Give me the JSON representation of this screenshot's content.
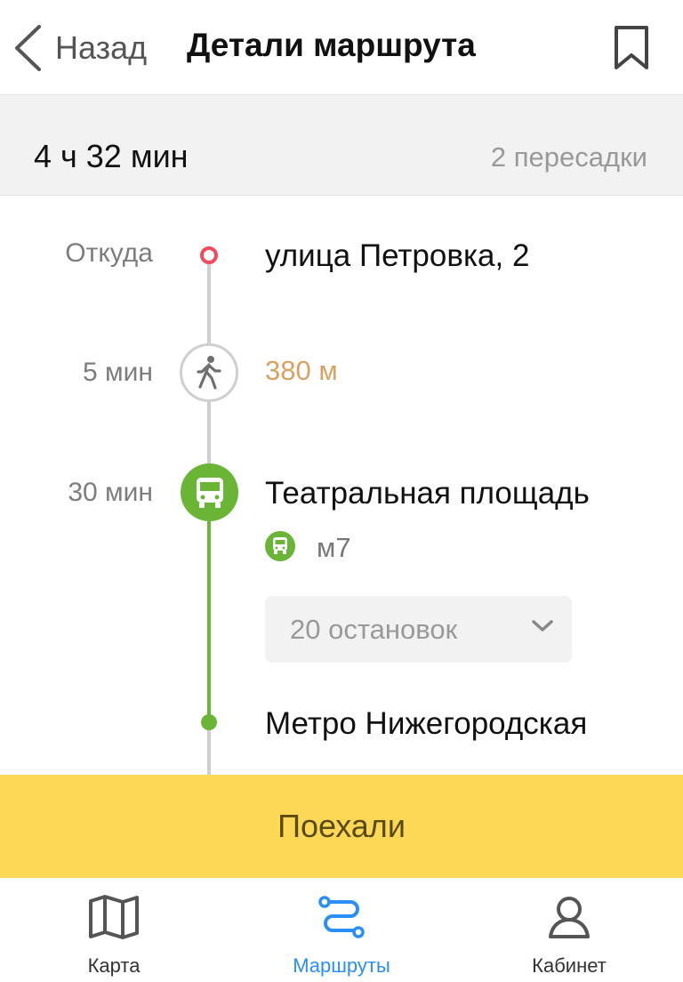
{
  "header": {
    "back_label": "Назад",
    "title": "Детали маршрута",
    "icons": {
      "back": "chevron-left-icon",
      "bookmark": "bookmark-icon"
    }
  },
  "summary": {
    "duration": "4 ч 32 мин",
    "transfers": "2 пересадки"
  },
  "timeline": {
    "origin": {
      "time_label": "Откуда",
      "place": "улица Петровка, 2"
    },
    "walk": {
      "time_label": "5 мин",
      "distance": "380 м",
      "icon": "walking-icon"
    },
    "bus": {
      "time_label": "30 мин",
      "stop": "Театральная площадь",
      "route": "м7",
      "stops_count": "20 остановок",
      "icon": "bus-icon"
    },
    "next_stop": {
      "place": "Метро Нижегородская"
    }
  },
  "action": {
    "go_label": "Поехали"
  },
  "tabbar": {
    "tabs": [
      {
        "label": "Карта",
        "icon": "map-icon",
        "active": false
      },
      {
        "label": "Маршруты",
        "icon": "routes-icon",
        "active": true
      },
      {
        "label": "Кабинет",
        "icon": "profile-icon",
        "active": false
      }
    ]
  },
  "colors": {
    "accent_green": "#6bb536",
    "go_yellow": "#fcd856",
    "active_tab_blue": "#2a8ef7",
    "distance_orange": "#d9a162",
    "origin_red": "#f24b5b"
  }
}
